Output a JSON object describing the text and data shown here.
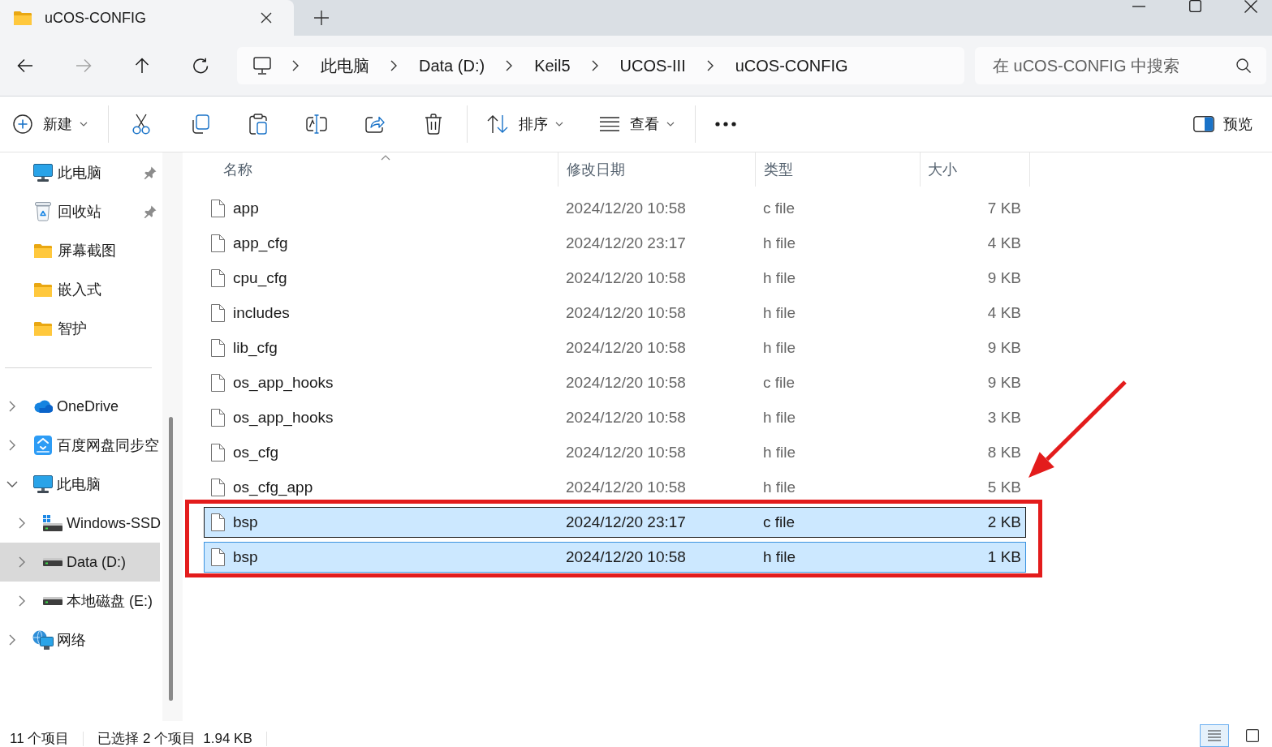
{
  "tabs": [
    {
      "title": "uCOS-CONFIG",
      "selected": true
    }
  ],
  "navigation": [
    {
      "kind": "back",
      "disabled": false
    },
    {
      "kind": "forward",
      "disabled": true
    },
    {
      "kind": "up",
      "disabled": false
    },
    {
      "kind": "refresh",
      "disabled": false
    }
  ],
  "address_bar": {
    "crumbs": [
      "此电脑",
      "Data (D:)",
      "Keil5",
      "UCOS-III",
      "uCOS-CONFIG"
    ]
  },
  "search": {
    "placeholder": "在 uCOS-CONFIG 中搜索"
  },
  "toolbar": {
    "groups": [
      [
        {
          "kind": "new",
          "label": "新建",
          "dropdown": true
        }
      ],
      [
        {
          "kind": "cut"
        },
        {
          "kind": "copy"
        },
        {
          "kind": "paste"
        },
        {
          "kind": "rename"
        },
        {
          "kind": "share"
        },
        {
          "kind": "delete"
        }
      ],
      [
        {
          "kind": "sort",
          "label": "排序",
          "dropdown": true
        },
        {
          "kind": "view",
          "label": "查看",
          "dropdown": true
        }
      ],
      [
        {
          "kind": "more"
        }
      ]
    ],
    "preview": {
      "label": "预览"
    }
  },
  "sidebar": {
    "quick_access": [
      {
        "kind": "computer",
        "label": "此电脑",
        "pinned": true
      },
      {
        "kind": "recycle_bin",
        "label": "回收站",
        "pinned": true
      },
      {
        "kind": "folder",
        "label": "屏幕截图",
        "pinned": false
      },
      {
        "kind": "folder",
        "label": "嵌入式",
        "pinned": false
      },
      {
        "kind": "folder",
        "label": "智护",
        "pinned": false
      }
    ],
    "tree": [
      {
        "kind": "cloud",
        "label": "OneDrive",
        "expanded": false,
        "selected": false
      },
      {
        "kind": "baidu",
        "label": "百度网盘同步空",
        "expanded": false,
        "selected": false
      },
      {
        "kind": "computer",
        "label": "此电脑",
        "expanded": true,
        "selected": false,
        "children": [
          {
            "kind": "windows_drive",
            "label": "Windows-SSD",
            "expanded": false,
            "selected": false
          },
          {
            "kind": "drive",
            "label": "Data (D:)",
            "expanded": false,
            "selected": true
          },
          {
            "kind": "drive",
            "label": "本地磁盘 (E:)",
            "expanded": false,
            "selected": false
          }
        ]
      },
      {
        "kind": "network",
        "label": "网络",
        "expanded": false,
        "selected": false
      }
    ]
  },
  "file_list": {
    "columns": [
      {
        "label": "名称",
        "sorted": true
      },
      {
        "label": "修改日期",
        "sorted": false
      },
      {
        "label": "类型",
        "sorted": false
      },
      {
        "label": "大小",
        "sorted": false
      }
    ],
    "rows": [
      {
        "name": "app",
        "modified": "2024/12/20 10:58",
        "type": "c file",
        "size": "7 KB",
        "selected": false,
        "focused": false
      },
      {
        "name": "app_cfg",
        "modified": "2024/12/20 23:17",
        "type": "h file",
        "size": "4 KB",
        "selected": false,
        "focused": false
      },
      {
        "name": "cpu_cfg",
        "modified": "2024/12/20 10:58",
        "type": "h file",
        "size": "9 KB",
        "selected": false,
        "focused": false
      },
      {
        "name": "includes",
        "modified": "2024/12/20 10:58",
        "type": "h file",
        "size": "4 KB",
        "selected": false,
        "focused": false
      },
      {
        "name": "lib_cfg",
        "modified": "2024/12/20 10:58",
        "type": "h file",
        "size": "9 KB",
        "selected": false,
        "focused": false
      },
      {
        "name": "os_app_hooks",
        "modified": "2024/12/20 10:58",
        "type": "c file",
        "size": "9 KB",
        "selected": false,
        "focused": false
      },
      {
        "name": "os_app_hooks",
        "modified": "2024/12/20 10:58",
        "type": "h file",
        "size": "3 KB",
        "selected": false,
        "focused": false
      },
      {
        "name": "os_cfg",
        "modified": "2024/12/20 10:58",
        "type": "h file",
        "size": "8 KB",
        "selected": false,
        "focused": false
      },
      {
        "name": "os_cfg_app",
        "modified": "2024/12/20 10:58",
        "type": "h file",
        "size": "5 KB",
        "selected": false,
        "focused": false
      },
      {
        "name": "bsp",
        "modified": "2024/12/20 23:17",
        "type": "c file",
        "size": "2 KB",
        "selected": true,
        "focused": true
      },
      {
        "name": "bsp",
        "modified": "2024/12/20 10:58",
        "type": "h file",
        "size": "1 KB",
        "selected": true,
        "focused": false
      }
    ]
  },
  "annotations": {
    "highlight_box": true,
    "arrow": true
  },
  "status_bar": {
    "item_count": "11 个项目",
    "selection": "已选择 2 个项目",
    "selection_size": "1.94 KB",
    "views": [
      {
        "kind": "details",
        "selected": true
      },
      {
        "kind": "tiles",
        "selected": false
      }
    ]
  }
}
